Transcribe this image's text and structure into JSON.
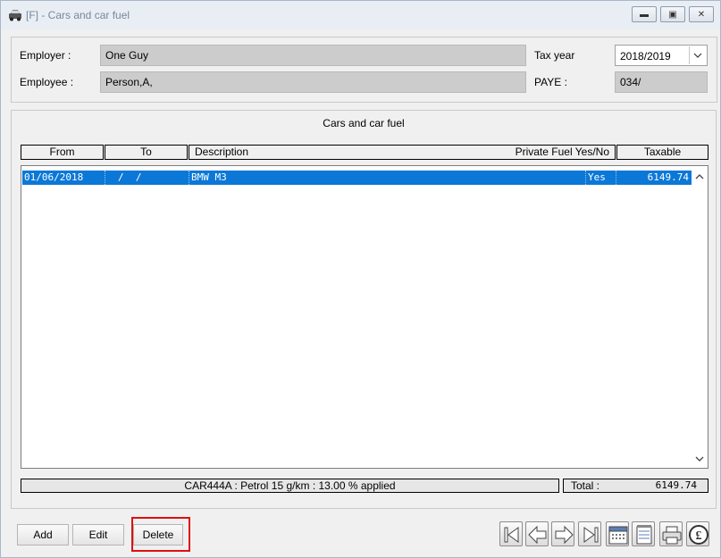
{
  "window": {
    "title": "[F] - Cars and car fuel"
  },
  "header": {
    "employer_label": "Employer :",
    "employer_value": "One Guy",
    "employee_label": "Employee :",
    "employee_value": "Person,A,",
    "tax_year_label": "Tax year",
    "tax_year_value": "2018/2019",
    "paye_label": "PAYE :",
    "paye_value": "034/"
  },
  "section": {
    "title": "Cars and car fuel"
  },
  "table": {
    "columns": [
      "From",
      "To",
      "Description",
      "Private Fuel Yes/No",
      "Taxable"
    ],
    "rows": [
      {
        "from": "01/06/2018",
        "to": "/  /",
        "description": "BMW M3",
        "private_fuel": "Yes",
        "taxable": "6149.74"
      }
    ]
  },
  "footer": {
    "status_text": "CAR444A : Petrol 15 g/km : 13.00 % applied",
    "total_label": "Total :",
    "total_value": "6149.74"
  },
  "buttons": {
    "add": "Add",
    "edit": "Edit",
    "delete": "Delete"
  },
  "icons": {
    "title": "car-icon",
    "nav": [
      "first-record-icon",
      "previous-record-icon",
      "next-record-icon",
      "last-record-icon",
      "calendar-icon",
      "notepad-icon",
      "printer-icon",
      "pound-icon"
    ]
  },
  "colors": {
    "selection": "#0b78d7",
    "highlight": "#e01010"
  }
}
